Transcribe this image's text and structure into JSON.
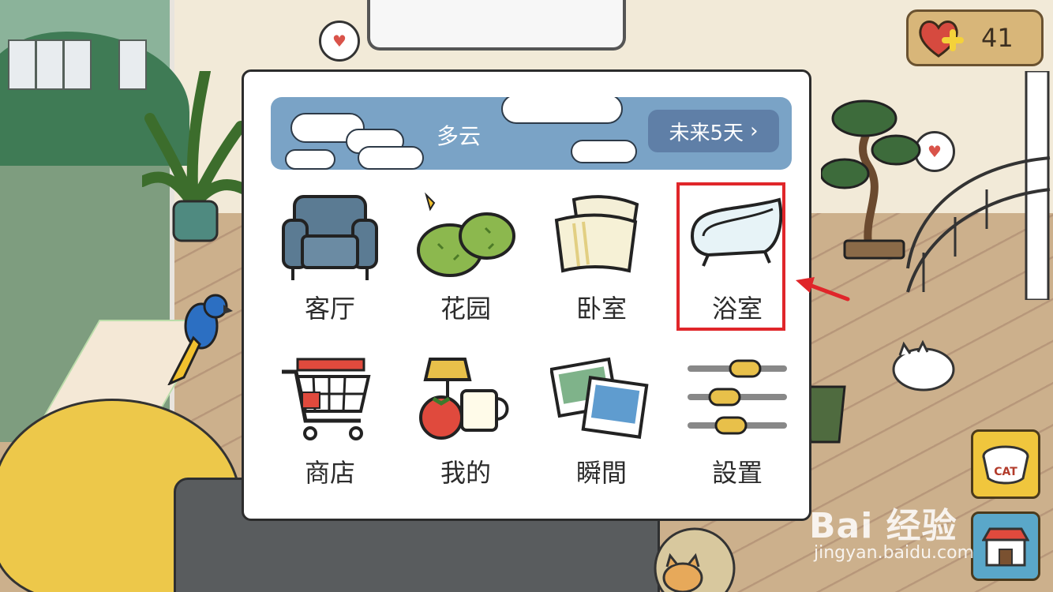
{
  "hud": {
    "heart_count": "41"
  },
  "menu": {
    "weather": {
      "condition": "多云",
      "forecast_label": "未来5天",
      "forecast_chevron": "›"
    },
    "items": [
      {
        "label": "客厅",
        "icon": "armchair-icon"
      },
      {
        "label": "花园",
        "icon": "garden-bush-icon"
      },
      {
        "label": "卧室",
        "icon": "pillows-icon"
      },
      {
        "label": "浴室",
        "icon": "bathtub-icon"
      },
      {
        "label": "商店",
        "icon": "shopping-cart-icon"
      },
      {
        "label": "我的",
        "icon": "lamp-tomato-mug-icon"
      },
      {
        "label": "瞬間",
        "icon": "photos-icon"
      },
      {
        "label": "設置",
        "icon": "sliders-icon"
      }
    ]
  },
  "side_buttons": {
    "cat_food_label": "CAT"
  },
  "watermark": {
    "brand": "Bai 经验",
    "url": "jingyan.baidu.com"
  },
  "colors": {
    "highlight": "#e0262a",
    "weather_bg": "#7aa3c6",
    "heart": "#d9534a"
  }
}
